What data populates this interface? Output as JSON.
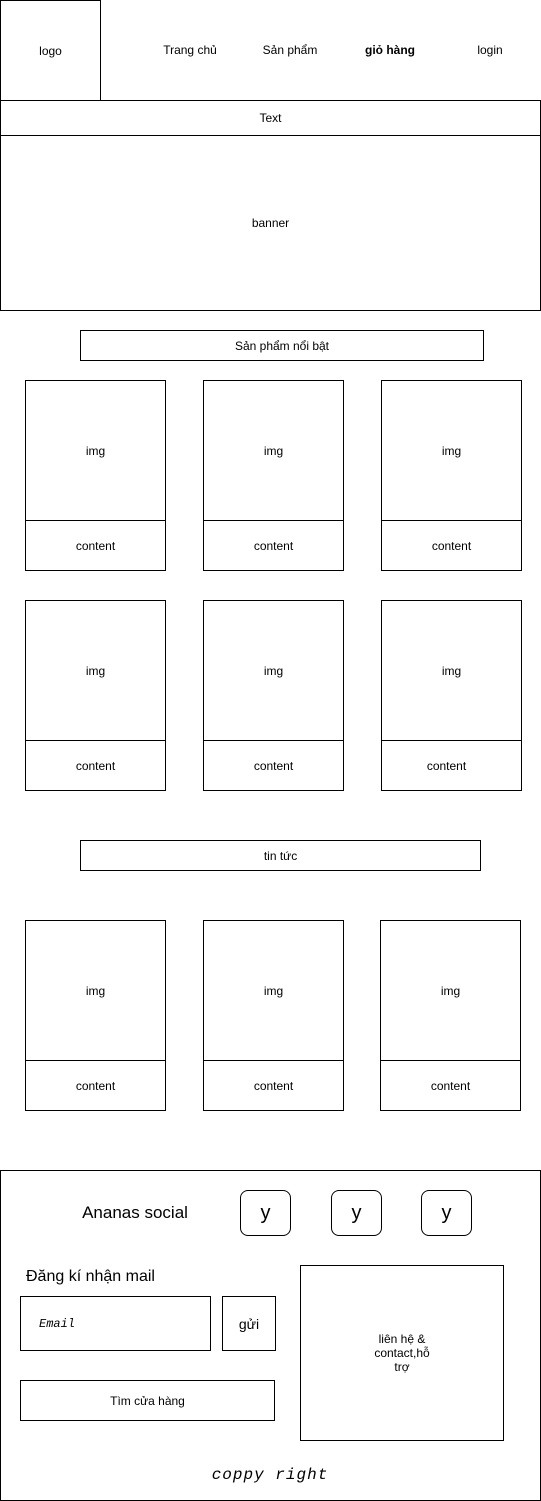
{
  "header": {
    "logo": "logo",
    "nav": [
      "Trang chủ",
      "Sản phẩm",
      "giỏ hàng",
      "login"
    ]
  },
  "top_text": "Text",
  "banner": "banner",
  "featured": {
    "title": "Sản phẩm nổi bật",
    "cards": [
      {
        "img": "img",
        "content": "content"
      },
      {
        "img": "img",
        "content": "content"
      },
      {
        "img": "img",
        "content": "content"
      },
      {
        "img": "img",
        "content": "content"
      },
      {
        "img": "img",
        "content": "content"
      },
      {
        "img": "img",
        "content": "content"
      }
    ]
  },
  "news": {
    "title": "tin tức",
    "cards": [
      {
        "img": "img",
        "content": "content"
      },
      {
        "img": "img",
        "content": "content"
      },
      {
        "img": "img",
        "content": "content"
      }
    ]
  },
  "footer": {
    "social_label": "Ananas social",
    "social_buttons": [
      "y",
      "y",
      "y"
    ],
    "newsletter_title": "Đăng kí nhận mail",
    "email_placeholder": "Email",
    "send_label": "gửi",
    "find_store_label": "Tìm cửa hàng",
    "contact_line1": "liên hệ &",
    "contact_line2": "contact,hỗ",
    "contact_line3": "trợ",
    "copyright": "coppy right"
  }
}
